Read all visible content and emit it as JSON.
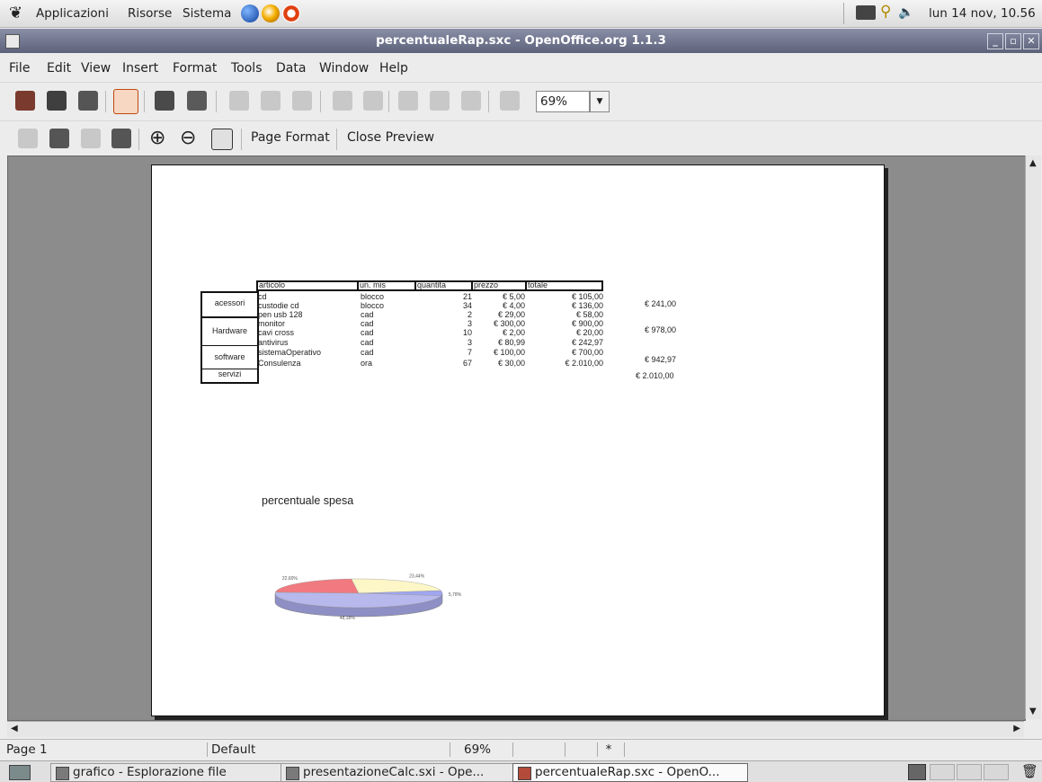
{
  "panel": {
    "menus": [
      "Applicazioni",
      "Risorse",
      "Sistema"
    ],
    "clock": "lun 14 nov, 10.56"
  },
  "window": {
    "title": "percentualeRap.sxc - OpenOffice.org 1.1.3"
  },
  "menubar": [
    "File",
    "Edit",
    "View",
    "Insert",
    "Format",
    "Tools",
    "Data",
    "Window",
    "Help"
  ],
  "toolbar": {
    "zoom_value": "69%"
  },
  "preview_toolbar": {
    "page_format_label": "Page Format",
    "close_preview_label": "Close Preview"
  },
  "sheet": {
    "headers": [
      "articolo",
      "un. mis",
      "quantita",
      "prezzo",
      "totale"
    ],
    "groups": [
      {
        "name": "acessori",
        "subtotal": "€ 241,00"
      },
      {
        "name": "Hardware",
        "subtotal": "€ 978,00"
      },
      {
        "name": "software",
        "subtotal": "€ 942,97"
      },
      {
        "name": "servizi",
        "subtotal": "€ 2.010,00"
      }
    ],
    "rows": [
      {
        "articolo": "cd",
        "unmis": "blocco",
        "quantita": "21",
        "prezzo": "€ 5,00",
        "totale": "€ 105,00"
      },
      {
        "articolo": "custodie cd",
        "unmis": "blocco",
        "quantita": "34",
        "prezzo": "€ 4,00",
        "totale": "€ 136,00"
      },
      {
        "articolo": "pen usb 128",
        "unmis": "cad",
        "quantita": "2",
        "prezzo": "€ 29,00",
        "totale": "€ 58,00"
      },
      {
        "articolo": "monitor",
        "unmis": "cad",
        "quantita": "3",
        "prezzo": "€ 300,00",
        "totale": "€ 900,00"
      },
      {
        "articolo": "cavi cross",
        "unmis": "cad",
        "quantita": "10",
        "prezzo": "€ 2,00",
        "totale": "€ 20,00"
      },
      {
        "articolo": "antivirus",
        "unmis": "cad",
        "quantita": "3",
        "prezzo": "€ 80,99",
        "totale": "€ 242,97"
      },
      {
        "articolo": "sistemaOperativo",
        "unmis": "cad",
        "quantita": "7",
        "prezzo": "€ 100,00",
        "totale": "€ 700,00"
      },
      {
        "articolo": "Consulenza",
        "unmis": "ora",
        "quantita": "67",
        "prezzo": "€ 30,00",
        "totale": "€ 2.010,00"
      }
    ]
  },
  "chart_data": {
    "type": "pie",
    "title": "percentuale spesa",
    "slices": [
      {
        "label": "22,60%",
        "value": 22.6,
        "color": "#f07a80"
      },
      {
        "label": "23,44%",
        "value": 23.44,
        "color": "#fdf6c6"
      },
      {
        "label": "5,78%",
        "value": 5.78,
        "color": "#9fa5f0"
      },
      {
        "label": "48,18%",
        "value": 48.18,
        "color": "#b7b8ec"
      }
    ]
  },
  "status": {
    "page": "Page 1",
    "style": "Default",
    "zoom": "69%",
    "modified": "*"
  },
  "taskbar": {
    "tasks": [
      "grafico - Esplorazione file",
      "presentazioneCalc.sxi - Ope...",
      "percentualeRap.sxc - OpenO..."
    ]
  },
  "colors": {
    "titlebar": "#6a7089",
    "workspace": "#8c8c8c"
  }
}
